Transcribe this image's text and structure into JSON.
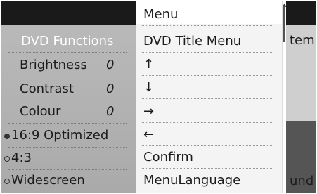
{
  "background": {
    "right_label_top": "tem",
    "right_label_bottom": "und"
  },
  "left_panel": {
    "title": "DVD Functions",
    "settings": [
      {
        "label": "Brightness",
        "value": "0"
      },
      {
        "label": "Contrast",
        "value": "0"
      },
      {
        "label": "Colour",
        "value": "0"
      }
    ],
    "format_options": [
      {
        "label": "16:9 Optimized",
        "selected": true
      },
      {
        "label": "4:3",
        "selected": false
      },
      {
        "label": "Widescreen",
        "selected": false
      }
    ]
  },
  "menu": {
    "header": "Menu",
    "items": [
      {
        "label": "DVD Title Menu",
        "icon": "none"
      },
      {
        "label": "↑",
        "icon": "arrow-up-icon"
      },
      {
        "label": "↓",
        "icon": "arrow-down-icon"
      },
      {
        "label": "→",
        "icon": "arrow-right-icon"
      },
      {
        "label": "←",
        "icon": "arrow-left-icon"
      },
      {
        "label": "Confirm",
        "icon": "none"
      },
      {
        "label": "MenuLanguage",
        "icon": "none"
      }
    ]
  },
  "colors": {
    "panel_bg": "#aaaaaa",
    "menu_bg": "#f4f4f4",
    "title_text": "#ffffff",
    "top_bar": "#1a1a1a"
  }
}
